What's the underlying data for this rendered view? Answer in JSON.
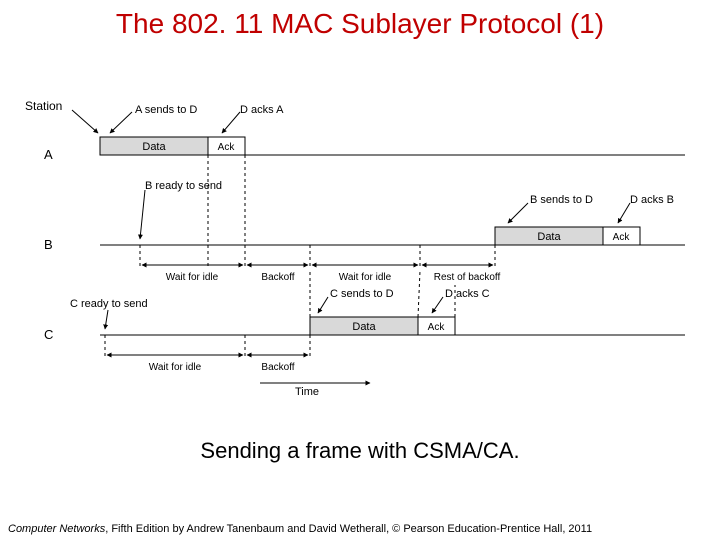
{
  "title": "The 802. 11 MAC Sublayer Protocol (1)",
  "caption": "Sending a frame with CSMA/CA.",
  "footer_book": "Computer Networks",
  "footer_rest": ", Fifth Edition by Andrew Tanenbaum and David Wetherall, © Pearson Education-Prentice Hall, 2011",
  "diagram": {
    "row_labels": {
      "station": "Station",
      "A": "A",
      "B": "B",
      "C": "C"
    },
    "block_labels": {
      "data": "Data",
      "ack": "Ack"
    },
    "top": {
      "a_sends_d": "A sends to D",
      "d_acks_a": "D acks A"
    },
    "row_b": {
      "b_ready": "B ready to send",
      "b_sends_d": "B sends to D",
      "d_acks_b": "D acks B",
      "wait_idle": "Wait for idle",
      "backoff": "Backoff",
      "wait_idle2": "Wait for idle",
      "rest_backoff": "Rest of backoff"
    },
    "row_c": {
      "c_ready": "C ready to send",
      "c_sends_d": "C sends to D",
      "d_acks_c": "D acks C",
      "wait_idle": "Wait for idle",
      "backoff": "Backoff"
    },
    "time": "Time"
  }
}
